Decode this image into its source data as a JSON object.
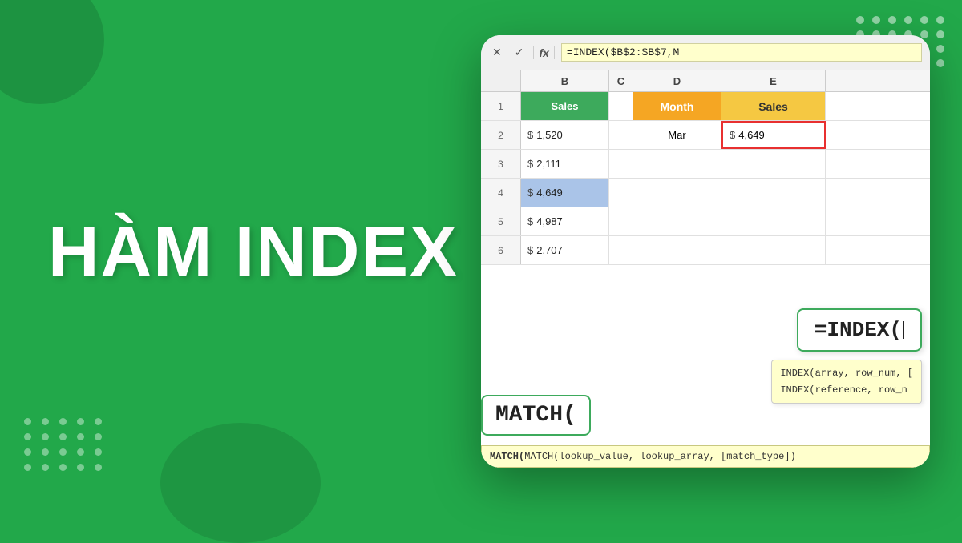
{
  "background_color": "#22a84a",
  "title": {
    "line1": "HÀM INDEX"
  },
  "decorative": {
    "dots_top_right_count": 24,
    "dots_bottom_left_count": 20
  },
  "formula_bar": {
    "cancel_btn": "✕",
    "confirm_btn": "✓",
    "fx_label": "fx",
    "formula": "=INDEX($B$2:$B$7,M"
  },
  "spreadsheet": {
    "col_headers": [
      "B",
      "C",
      "D",
      "E"
    ],
    "header_row": {
      "col_b": "Sales",
      "col_d": "Month",
      "col_e": "Sales"
    },
    "rows": [
      {
        "num": "2",
        "b_dollar": "$",
        "b_val": "1,520",
        "d_val": "Mar",
        "e_dollar": "$",
        "e_val": "4,649",
        "highlight_b": false,
        "highlight_e_red": true
      },
      {
        "num": "3",
        "b_dollar": "$",
        "b_val": "2,111",
        "highlight_b": false
      },
      {
        "num": "4",
        "b_dollar": "$",
        "b_val": "4,649",
        "highlight_b": true
      },
      {
        "num": "5",
        "b_dollar": "$",
        "b_val": "4,987",
        "highlight_b": false
      },
      {
        "num": "6",
        "b_dollar": "$",
        "b_val": "2,707",
        "highlight_b": false
      }
    ]
  },
  "index_formula_box": {
    "text": "=INDEX("
  },
  "index_tooltip": {
    "line1": "INDEX(array, row_num, [",
    "line2": "INDEX(reference, row_n"
  },
  "match_formula": {
    "text": "MATCH("
  },
  "match_tooltip": {
    "text": "MATCH(lookup_value, lookup_array, [match_type])"
  }
}
